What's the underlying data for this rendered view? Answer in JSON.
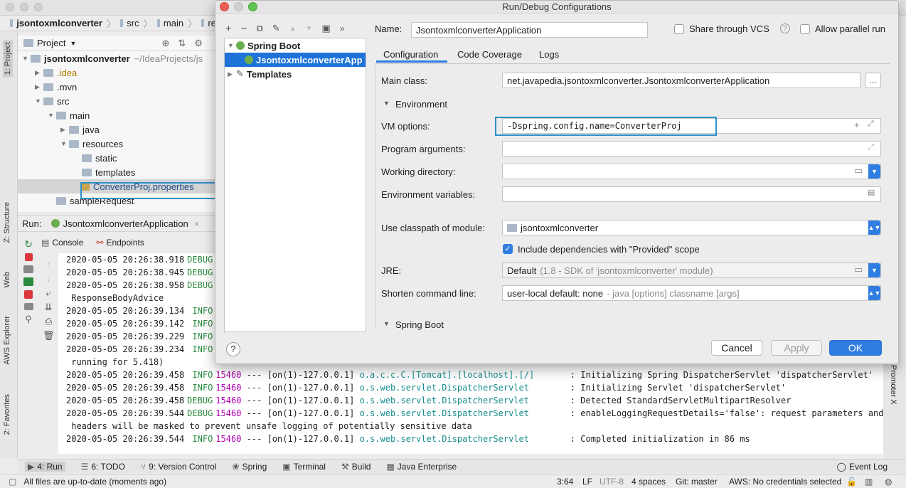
{
  "ide": {
    "breadcrumbs": [
      "jsontoxmlconverter",
      "src",
      "main",
      "re"
    ],
    "project_label": "Project",
    "tree": [
      {
        "label": "jsontoxmlconverter",
        "extra": "~/IdeaProjects/js",
        "indent": 0,
        "arrow": "▼",
        "bold": true
      },
      {
        "label": ".idea",
        "indent": 1,
        "arrow": "▶",
        "color": "#b07a00"
      },
      {
        "label": ".mvn",
        "indent": 1,
        "arrow": "▶"
      },
      {
        "label": "src",
        "indent": 1,
        "arrow": "▼"
      },
      {
        "label": "main",
        "indent": 2,
        "arrow": "▼"
      },
      {
        "label": "java",
        "indent": 3,
        "arrow": "▶"
      },
      {
        "label": "resources",
        "indent": 3,
        "arrow": "▼"
      },
      {
        "label": "static",
        "indent": 4,
        "arrow": ""
      },
      {
        "label": "templates",
        "indent": 4,
        "arrow": ""
      },
      {
        "label": "ConverterProj.properties",
        "indent": 4,
        "arrow": "",
        "selected": true,
        "color": "#1f4a8a"
      },
      {
        "label": "sampleRequest",
        "indent": 2,
        "arrow": ""
      }
    ],
    "run_label": "Run:",
    "run_config": "JsontoxmlconverterApplication",
    "console_tabs": [
      "Console",
      "Endpoints"
    ],
    "left_tabs": [
      "1: Project",
      "Z: Structure",
      "Web",
      "AWS Explorer",
      "2: Favorites"
    ],
    "right_tab": "Promoter X",
    "log_lines": [
      {
        "ts": "2020-05-05 20:26:38.918",
        "level": "DEBUG",
        "rest": ""
      },
      {
        "ts": "2020-05-05 20:26:38.945",
        "level": "DEBUG",
        "rest": ""
      },
      {
        "ts": "2020-05-05 20:26:38.958",
        "level": "DEBUG",
        "rest": ""
      },
      {
        "ts": "",
        "level": "",
        "rest": " ResponseBodyAdvice"
      },
      {
        "ts": "2020-05-05 20:26:39.134",
        "level": " INFO",
        "rest": ""
      },
      {
        "ts": "2020-05-05 20:26:39.142",
        "level": " INFO",
        "rest": ""
      },
      {
        "ts": "2020-05-05 20:26:39.229",
        "level": " INFO",
        "rest": ""
      },
      {
        "ts": "2020-05-05 20:26:39.234",
        "level": " INFO",
        "rest": ""
      },
      {
        "ts": "",
        "level": "",
        "rest": " running for 5.418)"
      },
      {
        "ts": "2020-05-05 20:26:39.458",
        "level": " INFO",
        "pid": "15460",
        "thread": " --- [on(1)-127.0.0.1] ",
        "cls": "o.a.c.c.C.[Tomcat].[localhost].[/]      ",
        "msg": " : Initializing Spring DispatcherServlet 'dispatcherServlet'"
      },
      {
        "ts": "2020-05-05 20:26:39.458",
        "level": " INFO",
        "pid": "15460",
        "thread": " --- [on(1)-127.0.0.1] ",
        "cls": "o.s.web.servlet.DispatcherServlet       ",
        "msg": " : Initializing Servlet 'dispatcherServlet'"
      },
      {
        "ts": "2020-05-05 20:26:39.458",
        "level": "DEBUG",
        "pid": "15460",
        "thread": " --- [on(1)-127.0.0.1] ",
        "cls": "o.s.web.servlet.DispatcherServlet       ",
        "msg": " : Detected StandardServletMultipartResolver"
      },
      {
        "ts": "2020-05-05 20:26:39.544",
        "level": "DEBUG",
        "pid": "15460",
        "thread": " --- [on(1)-127.0.0.1] ",
        "cls": "o.s.web.servlet.DispatcherServlet       ",
        "msg": " : enableLoggingRequestDetails='false': request parameters and"
      },
      {
        "ts": "",
        "level": "",
        "rest": " headers will be masked to prevent unsafe logging of potentially sensitive data"
      },
      {
        "ts": "2020-05-05 20:26:39.544",
        "level": " INFO",
        "pid": "15460",
        "thread": " --- [on(1)-127.0.0.1] ",
        "cls": "o.s.web.servlet.DispatcherServlet       ",
        "msg": " : Completed initialization in 86 ms"
      }
    ],
    "bottom_tabs": [
      "4: Run",
      "6: TODO",
      "9: Version Control",
      "Spring",
      "Terminal",
      "Build",
      "Java Enterprise"
    ],
    "event_log": "Event Log",
    "status_left": "All files are up-to-date (moments ago)",
    "status_right": {
      "pos": "3:64",
      "lf": "LF",
      "enc": "UTF-8",
      "indent": "4 spaces",
      "git": "Git: master",
      "aws": "AWS: No credentials selected"
    }
  },
  "dialog": {
    "title": "Run/Debug Configurations",
    "toolbar_icons": [
      "+",
      "−",
      "⧉",
      "✎",
      "▲",
      "▼",
      "▣",
      "»"
    ],
    "tree": {
      "spring_boot": "Spring Boot",
      "app": "JsontoxmlconverterApp",
      "templates": "Templates"
    },
    "name_label": "Name:",
    "name_value": "JsontoxmlconverterApplication",
    "share_vcs": "Share through VCS",
    "allow_parallel": "Allow parallel run",
    "tabs": [
      "Configuration",
      "Code Coverage",
      "Logs"
    ],
    "main_class_label": "Main class:",
    "main_class_value": "net.javapedia.jsontoxmlconverter.JsontoxmlconverterApplication",
    "environment_label": "Environment",
    "vm_options_label": "VM options:",
    "vm_options_value": "-Dspring.config.name=ConverterProj",
    "program_args_label": "Program arguments:",
    "working_dir_label": "Working directory:",
    "env_vars_label": "Environment variables:",
    "classpath_label": "Use classpath of module:",
    "classpath_value": "jsontoxmlconverter",
    "include_deps": "Include dependencies with \"Provided\" scope",
    "jre_label": "JRE:",
    "jre_value": "Default",
    "jre_hint": "(1.8 - SDK of 'jsontoxmlconverter' module)",
    "shorten_label": "Shorten command line:",
    "shorten_value": "user-local default: none",
    "shorten_hint": "- java [options] classname [args]",
    "spring_boot_section": "Spring Boot",
    "buttons": {
      "cancel": "Cancel",
      "apply": "Apply",
      "ok": "OK"
    },
    "help": "?"
  },
  "colors": {
    "accent": "#2f7de1",
    "highlight_box": "#2d90c9",
    "selection": "#1e73d9"
  }
}
